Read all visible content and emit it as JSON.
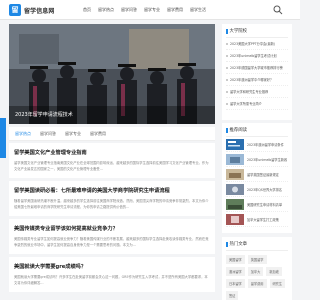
{
  "header": {
    "logo_mark": "留",
    "logo_text": "留学信息网",
    "nav": [
      "首页",
      "留学热点",
      "留学问答",
      "留学专业",
      "留学费用",
      "留学生活"
    ]
  },
  "banner": {
    "caption": "2023年留学申请流程技术"
  },
  "tabs": [
    "留学热点",
    "留学问答",
    "留学专业",
    "留学费用"
  ],
  "articles": [
    {
      "title": "留学美国文化产业管理专业指南",
      "summary": "留学美国文化产业管理专业指南美国文化产业在全球范围内影响深远，越来越多的国际学生选择前往美国学习文化产业管理专业。作为文化产业最发达的国家之一，美国的文化产业管理专业备受..."
    },
    {
      "title": "留学美国读研必看：七所最难申请的美国大学商学院研究生申请流程",
      "summary": "随着留学美国读研热潮不断升温，越来越多的学生选择前往美国商学院深造。然而，美国顶尖商学院的申请竞争非常激烈，本文为你介绍美国七所最难申请的商学院研究生申请流程，为你的申请之路提供有价值的..."
    },
    {
      "title": "美国传媒类专业留学该如何提高就业竞争力？",
      "summary": "美国传媒类专业留学生如何提高就业竞争力？随着美国传媒行业的不断发展，越来越多的国际学生选择赴美攻读传媒类专业，然而在竞争激烈的就业市场中，留学生如何提高自身竞争力是一个需要思考的问题。本文为..."
    },
    {
      "title": "美国就读大学需要gre成绩吗？",
      "summary": "美国就读大学需要gre成绩吗？许多学生在赴美留学前都会关心这一问题，GRE作为研究生入学考试，并不是所有美国大学都要求，本文将为你详细解答..."
    }
  ],
  "sidebar": {
    "hot_title": "大学院校",
    "hot_list": [
      "2023美国大学PPT分享会(最新)",
      "2023年unimelb留学生考试计划",
      "2023年德国留学大学城市推荐排行榜",
      "2023年澳洲留学中介哪家好？",
      "留学大学和研究生专业推荐",
      "留学大学所需专业简介",
      "2023年美国大学录取标准和要求",
      "2023年澳洲大学有哪些专业？最新2...",
      "2023年美国大学录取标准：最新汇..."
    ],
    "recommend_title": "推荐阅读",
    "recommend_list": [
      "2023年澳洲留学申请条件",
      "2023年unimelb留学生新政",
      "留学英国签证最新规定",
      "2023年QS世界大学排名",
      "美国研究生申请材料清单",
      "加拿大留学生打工政策",
      "2023年新西兰留学费用"
    ],
    "tags_title": "热门文章",
    "tags": [
      "美国留学",
      "英国留学",
      "澳洲留学",
      "加拿大",
      "新加坡",
      "日本留学",
      "留学费用",
      "研究生",
      "签证"
    ]
  },
  "colors": {
    "accent": "#1e88e5",
    "banner_bg": "#3b3f45"
  }
}
